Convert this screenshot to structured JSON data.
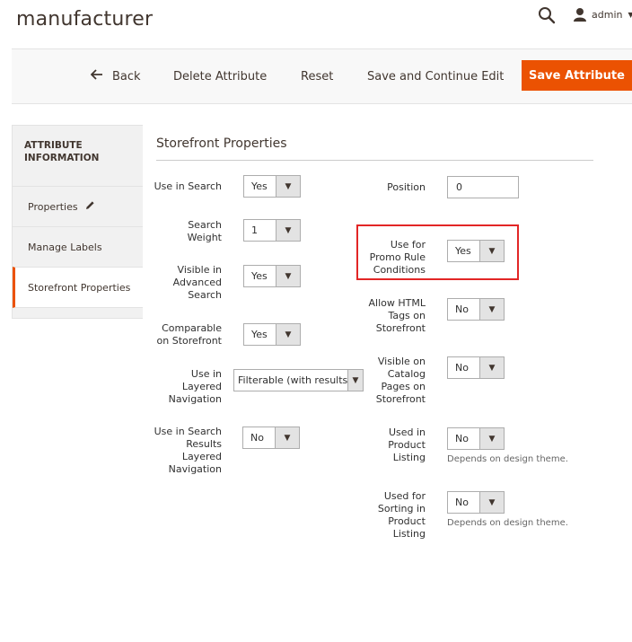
{
  "header": {
    "page_title": "manufacturer",
    "user_name": "admin"
  },
  "actions": {
    "back_label": "Back",
    "delete_label": "Delete Attribute",
    "reset_label": "Reset",
    "save_continue_label": "Save and Continue Edit",
    "save_label": "Save Attribute"
  },
  "sidebar": {
    "heading_line1": "ATTRIBUTE",
    "heading_line2": "INFORMATION",
    "tabs": [
      {
        "label": "Properties",
        "icon": "pencil-icon"
      },
      {
        "label": "Manage Labels"
      },
      {
        "label": "Storefront Properties",
        "active": true
      }
    ]
  },
  "storefront": {
    "title": "Storefront Properties",
    "left_fields": [
      {
        "label": [
          "Use in Search"
        ],
        "value": "Yes"
      },
      {
        "label": [
          "Search",
          "Weight"
        ],
        "value": "1"
      },
      {
        "label": [
          "Visible in",
          "Advanced",
          "Search"
        ],
        "value": "Yes"
      },
      {
        "label": [
          "Comparable",
          "on Storefront"
        ],
        "value": "Yes"
      },
      {
        "label": [
          "Use in",
          "Layered",
          "Navigation"
        ],
        "value": "Filterable (with results)"
      },
      {
        "label": [
          "Use in Search",
          "Results",
          "Layered",
          "Navigation"
        ],
        "value": "No"
      }
    ],
    "right_fields": [
      {
        "label": [
          "Position"
        ],
        "value": "0"
      },
      {
        "label": [
          "Use for",
          "Promo Rule",
          "Conditions"
        ],
        "value": "Yes"
      },
      {
        "label": [
          "Allow HTML",
          "Tags on",
          "Storefront"
        ],
        "value": "No"
      },
      {
        "label": [
          "Visible on",
          "Catalog",
          "Pages on",
          "Storefront"
        ],
        "value": "No"
      },
      {
        "label": [
          "Used in",
          "Product",
          "Listing"
        ],
        "value": "No",
        "note": "Depends on design theme."
      },
      {
        "label": [
          "Used for",
          "Sorting in",
          "Product",
          "Listing"
        ],
        "value": "No",
        "note": "Depends on design theme."
      }
    ]
  },
  "colors": {
    "accent": "#eb5202",
    "highlight": "#e22626"
  }
}
